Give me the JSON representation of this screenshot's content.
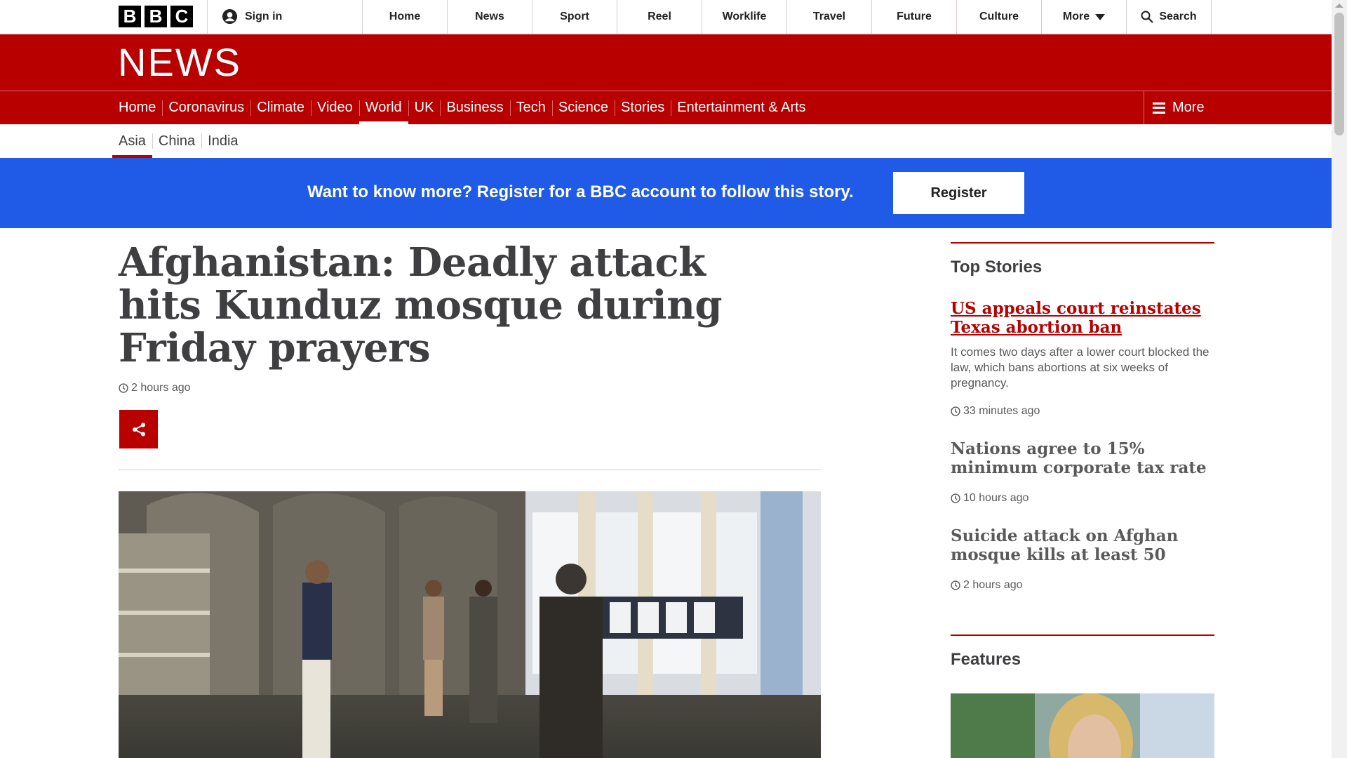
{
  "global_bar": {
    "logo_letters": [
      "B",
      "B",
      "C"
    ],
    "sign_in": "Sign in",
    "nav": [
      "Home",
      "News",
      "Sport",
      "Reel",
      "Worklife",
      "Travel",
      "Future",
      "Culture"
    ],
    "more": "More",
    "search": "Search"
  },
  "masthead": {
    "wordmark": "NEWS"
  },
  "news_nav": {
    "items": [
      "Home",
      "Coronavirus",
      "Climate",
      "Video",
      "World",
      "UK",
      "Business",
      "Tech",
      "Science",
      "Stories",
      "Entertainment & Arts"
    ],
    "active": "World",
    "more": "More"
  },
  "subnav": {
    "items": [
      "Asia",
      "China",
      "India"
    ],
    "active": "Asia"
  },
  "banner": {
    "text": "Want to know more? Register for a BBC account to follow this story.",
    "register": "Register"
  },
  "article": {
    "headline": "Afghanistan: Deadly attack hits Kunduz mosque during Friday prayers",
    "timestamp": "2 hours ago"
  },
  "sidebar": {
    "top_stories_heading": "Top Stories",
    "stories": [
      {
        "title": "US appeals court reinstates Texas abortion ban",
        "summary": "It comes two days after a lower court blocked the law, which bans abortions at six weeks of pregnancy.",
        "time": "33 minutes ago"
      },
      {
        "title": "Nations agree to 15% minimum corporate tax rate",
        "time": "10 hours ago"
      },
      {
        "title": "Suicide attack on Afghan mosque kills at least 50",
        "time": "2 hours ago"
      }
    ],
    "features_heading": "Features"
  },
  "colors": {
    "bbc_red": "#b80000",
    "banner_blue": "#1f5be6",
    "text_dark": "#3f3f42"
  },
  "icons": [
    "user-icon",
    "chevron-down-icon",
    "search-icon",
    "hamburger-icon",
    "clock-icon",
    "share-icon"
  ]
}
